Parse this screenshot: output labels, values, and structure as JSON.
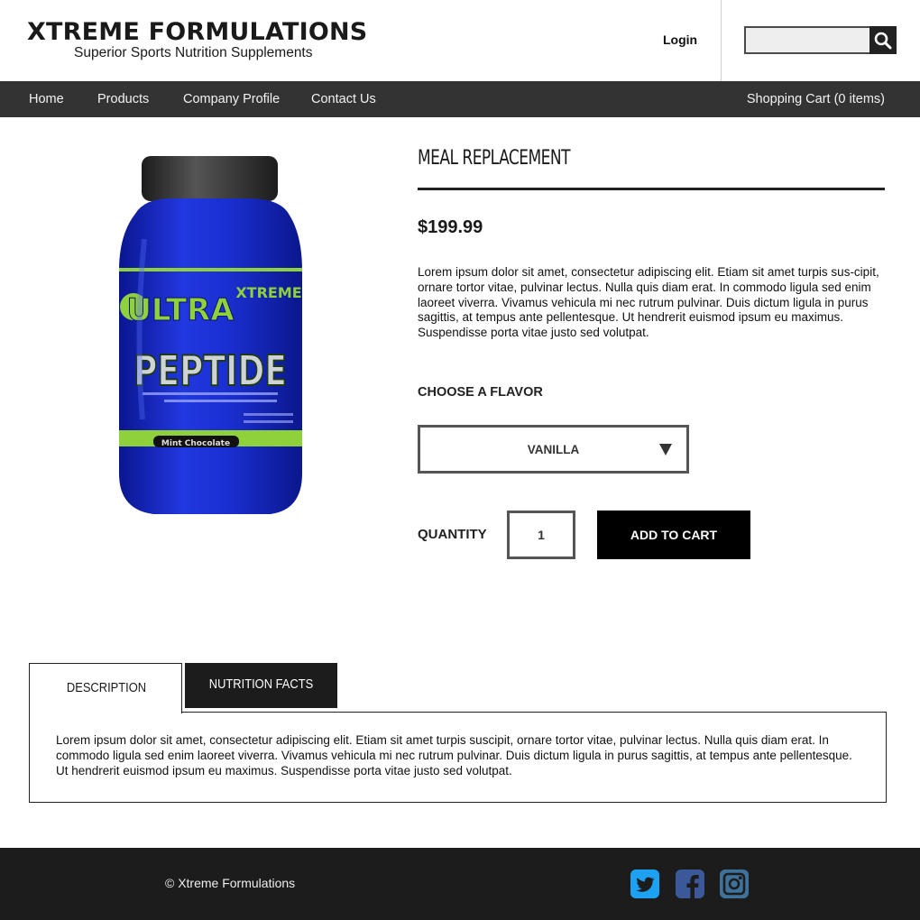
{
  "header": {
    "brand_title": "XTREME FORMULATIONS",
    "brand_subtitle": "Superior Sports Nutrition Supplements",
    "login_label": "Login",
    "search_placeholder": "",
    "search_icon": "search-icon"
  },
  "nav": {
    "items": [
      {
        "label": "Home"
      },
      {
        "label": "Products"
      },
      {
        "label": "Company Profile"
      },
      {
        "label": "Contact Us"
      }
    ],
    "cart_label": "Shopping Cart (0 items)"
  },
  "product": {
    "image_label": {
      "brand": "XTREME",
      "line1": "ULTRA",
      "line2": "PEPTIDE",
      "flavor": "Mint Chocolate"
    },
    "title": "MEAL REPLACEMENT",
    "price": "$199.99",
    "description": "Lorem ipsum dolor sit amet, consectetur adipiscing elit. Etiam sit amet turpis sus-cipit, ornare tortor vitae, pulvinar lectus. Nulla quis diam erat. In commodo ligula sed enim laoreet viverra. Vivamus vehicula mi nec rutrum pulvinar. Duis dictum ligula in purus sagittis, at tempus ante pellentesque. Ut hendrerit euismod ipsum eu maximus. Suspendisse porta vitae justo sed volutpat.",
    "flavor_label": "CHOOSE A FLAVOR",
    "flavor_value": "VANILLA",
    "quantity_label": "QUANTITY",
    "quantity_value": "1",
    "add_to_cart_label": "ADD TO CART"
  },
  "tabs": {
    "items": [
      {
        "label": "DESCRIPTION",
        "active": true
      },
      {
        "label": "NUTRITION FACTS",
        "active": false
      }
    ],
    "content": "Lorem ipsum dolor sit amet, consectetur adipiscing elit. Etiam sit amet turpis suscipit, ornare tortor vitae, pulvinar lectus. Nulla quis diam erat. In commodo ligula sed enim laoreet viverra. Vivamus vehicula mi nec rutrum pulvinar. Duis dictum ligula in purus sagittis, at tempus ante pellentesque. Ut hendrerit euismod ipsum eu maximus. Suspendisse porta vitae justo sed volutpat."
  },
  "footer": {
    "copyright": "© Xtreme Formulations",
    "social": [
      "twitter-icon",
      "facebook-icon",
      "instagram-icon"
    ]
  },
  "colors": {
    "nav_bg": "#333333",
    "footer_bg": "#1c1c1c",
    "twitter": "#1da1f2",
    "facebook": "#3b5998",
    "instagram": "#3f729b",
    "jar_blue": "#1a2fd6",
    "label_green": "#8fd13a"
  }
}
